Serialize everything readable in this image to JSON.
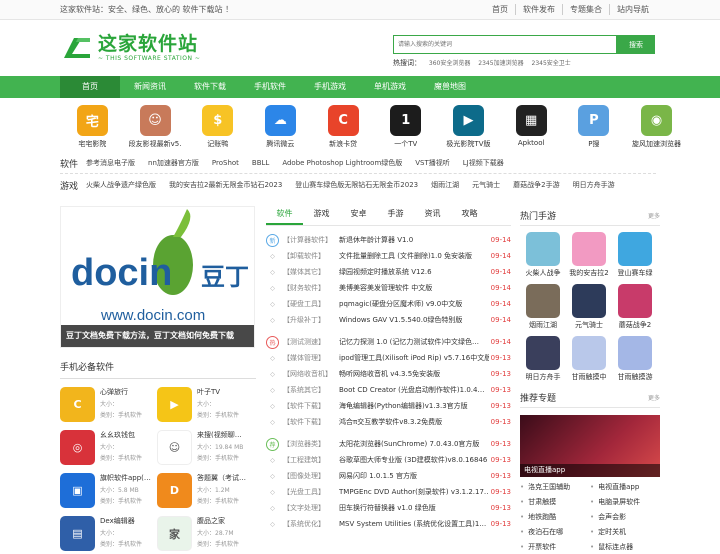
{
  "topbar": {
    "slogan": "这家软件站：安全、绿色、放心的 软件下载站 ！",
    "links": [
      "首页",
      "软件发布",
      "专题集合",
      "站内导航"
    ]
  },
  "header": {
    "logo_title": "这家软件站",
    "logo_sub": "~ THIS SOFTWARE STATION ~",
    "search_placeholder": "请输入搜索的关键词",
    "search_button": "搜索",
    "hot_label": "热搜词：",
    "hot_words": [
      "360安全浏览器",
      "2345加速浏览器",
      "2345安全卫士"
    ]
  },
  "nav": [
    "首页",
    "新闻资讯",
    "软件下载",
    "手机软件",
    "手机游戏",
    "单机游戏",
    "魔兽地图"
  ],
  "apps": [
    {
      "name": "宅宅影院",
      "color": "#f2a516",
      "glyph": "宅"
    },
    {
      "name": "段友影视最新v5.",
      "color": "#c87a5a",
      "glyph": "☺"
    },
    {
      "name": "记账鸭",
      "color": "#f7c325",
      "glyph": "$"
    },
    {
      "name": "腾讯微云",
      "color": "#2c86e8",
      "glyph": "☁"
    },
    {
      "name": "新浪卡贷",
      "color": "#e8442a",
      "glyph": "C"
    },
    {
      "name": "一个TV",
      "color": "#1c1c1c",
      "glyph": "1"
    },
    {
      "name": "极光影院TV版",
      "color": "#0d6b8a",
      "glyph": "▶"
    },
    {
      "name": "Apktool",
      "color": "#222222",
      "glyph": "▦"
    },
    {
      "name": "P搜",
      "color": "#5aa0e0",
      "glyph": "P"
    },
    {
      "name": "旋风加速浏览器",
      "color": "#7ab648",
      "glyph": "◉"
    }
  ],
  "software_row": {
    "label": "软件",
    "items": [
      "参考消息电子版",
      "nn加速器官方版",
      "ProShot",
      "BBLL",
      "Adobe Photoshop Lightroom绿色版",
      "VST播视听",
      "LJ视频下载器"
    ]
  },
  "game_row": {
    "label": "游戏",
    "items": [
      "火柴人战争遗产绿色版",
      "我的安吉拉2最新无限金币钻石2023",
      "登山赛车绿色版无限钻石无限金币2023",
      "烟雨江湖",
      "元气骑士",
      "蘑菇战争2手游",
      "明日方舟手游"
    ]
  },
  "banner": {
    "caption": "豆丁文档免费下载方法，豆丁文档如何免费下载",
    "brand": "docin",
    "brand_cn": "豆丁",
    "url": "www.docin.com"
  },
  "must_soft": {
    "title": "手机必备软件",
    "items": [
      {
        "name": "心弹旅行",
        "size": "大小：",
        "type": "类别：手机软件",
        "color": "#f2b51c",
        "glyph": "C"
      },
      {
        "name": "叶子TV",
        "size": "大小：",
        "type": "类别：手机软件",
        "color": "#f5c517",
        "glyph": "▶"
      },
      {
        "name": "幺幺玖钱包",
        "size": "大小：",
        "type": "类别：手机软件",
        "color": "#d8323a",
        "glyph": "◎"
      },
      {
        "name": "来搜(视频聊…",
        "size": "大小：19.84 MB",
        "type": "类别：手机软件",
        "color": "#ffffff",
        "glyph": "☺"
      },
      {
        "name": "旗帜软件app(…",
        "size": "大小：5.8 MB",
        "type": "类别：手机软件",
        "color": "#1e6ed8",
        "glyph": "▣"
      },
      {
        "name": "答题翼（考试…",
        "size": "大小：1.2M",
        "type": "类别：手机软件",
        "color": "#f08a1c",
        "glyph": "D"
      },
      {
        "name": "Dex编辑器",
        "size": "大小：",
        "type": "类别：手机软件",
        "color": "#2f5fa8",
        "glyph": "▤"
      },
      {
        "name": "腹品之家",
        "size": "大小：28.7M",
        "type": "类别：手机软件",
        "color": "#e9f4ea",
        "glyph": "家"
      }
    ]
  },
  "tabs": [
    "软件",
    "游戏",
    "安卓",
    "手游",
    "资讯",
    "攻略"
  ],
  "groups": [
    {
      "badge": "新",
      "rows": [
        {
          "cat": "【计算器软件】",
          "title": "新退休年龄计算器 V1.0",
          "date": "09-14"
        },
        {
          "cat": "【卸载软件】",
          "title": "文件批量删除工具 (文件删除)1.0 免安装版",
          "date": "09-14"
        },
        {
          "cat": "【媒体其它】",
          "title": "绿园视频定时播放系统 V12.6",
          "date": "09-14"
        },
        {
          "cat": "【财务软件】",
          "title": "美博美容美发管理软件 中文版",
          "date": "09-14"
        },
        {
          "cat": "【硬盘工具】",
          "title": "pqmagic(硬盘分区魔术师) v9.0中文版",
          "date": "09-14"
        },
        {
          "cat": "【升级补丁】",
          "title": "Windows GAV V1.5.540.0绿色特别版",
          "date": "09-14"
        }
      ]
    },
    {
      "badge": "热",
      "rows": [
        {
          "cat": "【测试测速】",
          "title": "记忆力探测 1.0 (记忆力测试软件)中文绿色…",
          "date": "09-14"
        },
        {
          "cat": "【媒体管理】",
          "title": "ipod管理工具(Xilisoft iPod Rip) v5.7.16中文版",
          "date": "09-13"
        },
        {
          "cat": "【网络收音机】",
          "title": "畅听网络收音机 v4.3.5免安装版",
          "date": "09-13"
        },
        {
          "cat": "【系统其它】",
          "title": "Boot CD Creator (光盘启动制作软件)1.0.4…",
          "date": "09-13"
        },
        {
          "cat": "【软件下载】",
          "title": "海龟编辑器(Python编辑器)v1.3.3官方版",
          "date": "09-13"
        },
        {
          "cat": "【软件下载】",
          "title": "鸿合π交互教学软件v8.3.2免费版",
          "date": "09-13"
        }
      ]
    },
    {
      "badge": "荐",
      "rows": [
        {
          "cat": "【浏览器类】",
          "title": "太阳花浏览器(SunChrome) 7.0.43.0官方版",
          "date": "09-13"
        },
        {
          "cat": "【工程建筑】",
          "title": "谷歌草图大师专业版 (3D建模软件)v8.0.16846",
          "date": "09-13"
        },
        {
          "cat": "【图像处理】",
          "title": "网易闪印 1.0.1.5 官方版",
          "date": "09-13"
        },
        {
          "cat": "【光盘工具】",
          "title": "TMPGEnc DVD Author(刻录软件) v3.1.2.17…",
          "date": "09-13"
        },
        {
          "cat": "【文字处理】",
          "title": "田车换行符替换器 v1.0 绿色版",
          "date": "09-13"
        },
        {
          "cat": "【系统优化】",
          "title": "MSV System Utilities (系统优化设置工具)1…",
          "date": "09-13"
        }
      ]
    }
  ],
  "hot_games": {
    "title": "热门手游",
    "more": "更多",
    "items": [
      {
        "name": "火柴人战争",
        "color": "#7cc0d9"
      },
      {
        "name": "我的安吉拉2",
        "color": "#f29ac2"
      },
      {
        "name": "登山赛车绿",
        "color": "#3fa7e0"
      },
      {
        "name": "烟雨江湖",
        "color": "#7a6c5a"
      },
      {
        "name": "元气骑士",
        "color": "#2d3b5a"
      },
      {
        "name": "蘑菇战争2",
        "color": "#c83b6a"
      },
      {
        "name": "明日方舟手",
        "color": "#3a3f5c"
      },
      {
        "name": "甘雨触摸中",
        "color": "#b9c8ea"
      },
      {
        "name": "甘雨触摸游",
        "color": "#a4b7e6"
      }
    ]
  },
  "recommend": {
    "title": "推荐专题",
    "more": "更多",
    "banner_caption": "电视直播app",
    "items": [
      "洛克王国辅助",
      "电视直播app",
      "甘肃触摸",
      "电脑录屏软件",
      "地铁跑酷",
      "会声会影",
      "夜泊石在哪",
      "定时关机",
      "开票软件",
      "鼠标连点器"
    ]
  }
}
